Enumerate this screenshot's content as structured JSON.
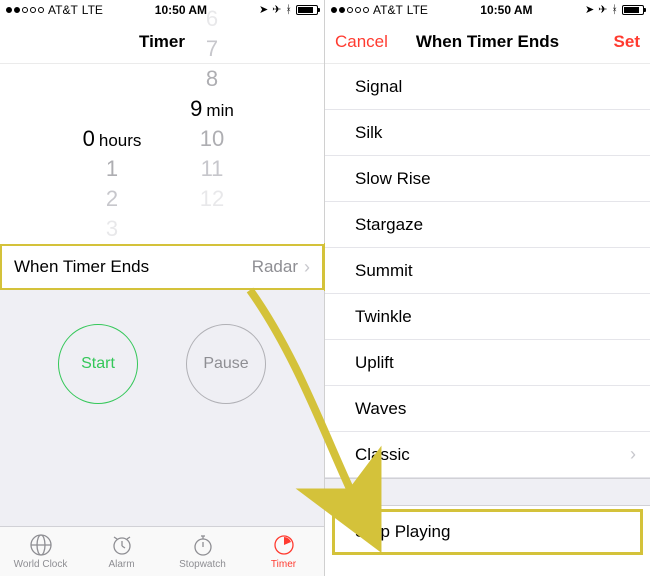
{
  "status": {
    "carrier": "AT&T",
    "network": "LTE",
    "time": "10:50 AM"
  },
  "left": {
    "title": "Timer",
    "picker": {
      "hours_above": "",
      "hours_selected": "0",
      "hours_below1": "1",
      "hours_below2": "2",
      "hours_below3": "3",
      "hours_unit": "hours",
      "min_above3": "6",
      "min_above2": "7",
      "min_above1": "8",
      "min_selected": "9",
      "min_below1": "10",
      "min_below2": "11",
      "min_below3": "12",
      "min_unit": "min"
    },
    "ends_cell": {
      "label": "When Timer Ends",
      "value": "Radar"
    },
    "buttons": {
      "start": "Start",
      "pause": "Pause"
    },
    "tabs": {
      "world_clock": "World Clock",
      "alarm": "Alarm",
      "stopwatch": "Stopwatch",
      "timer": "Timer"
    }
  },
  "right": {
    "cancel": "Cancel",
    "title": "When Timer Ends",
    "set": "Set",
    "sounds": {
      "s0": "Signal",
      "s1": "Silk",
      "s2": "Slow Rise",
      "s3": "Stargaze",
      "s4": "Summit",
      "s5": "Twinkle",
      "s6": "Uplift",
      "s7": "Waves",
      "classic": "Classic"
    },
    "stop_playing": "Stop Playing"
  }
}
